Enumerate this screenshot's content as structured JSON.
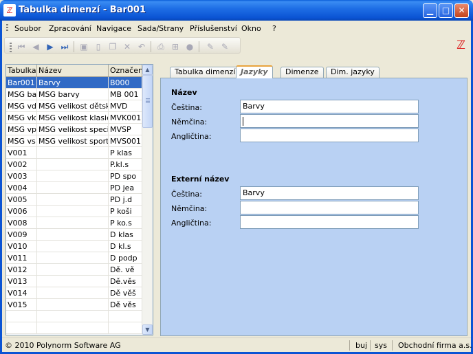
{
  "window": {
    "title": "Tabulka dimenzí - Bar001",
    "logo_icon": "polynorm-logo-icon",
    "accent_color": "#0b54d4"
  },
  "menu": {
    "items": [
      "Soubor",
      "Zpracování",
      "Navigace",
      "Sada/Strany",
      "Příslušenství",
      "Okno",
      "?"
    ]
  },
  "toolbar": {
    "buttons": [
      "first-record-icon",
      "previous-record-icon",
      "next-record-icon",
      "last-record-icon",
      "save-icon",
      "new-icon",
      "copy-icon",
      "delete-icon",
      "undo-icon",
      "print-icon",
      "tree-icon",
      "stop-icon",
      "edit-icon",
      "edit-alt-icon"
    ]
  },
  "grid": {
    "columns": [
      "Tabulka",
      "Název",
      "Označen"
    ],
    "rows": [
      {
        "c1": "Bar001",
        "c2": "Barvy",
        "c3": "B000",
        "selected": true
      },
      {
        "c1": "MSG ba",
        "c2": "MSG barvy",
        "c3": "MB 001"
      },
      {
        "c1": "MSG vd",
        "c2": "MSG velikost dětská",
        "c3": "MVD"
      },
      {
        "c1": "MSG vk",
        "c2": "MSG velikost klasick.",
        "c3": "MVK001"
      },
      {
        "c1": "MSG vp",
        "c2": "MSG velikost speciál",
        "c3": "MVSP"
      },
      {
        "c1": "MSG vs",
        "c2": "MSG velikost sportov",
        "c3": "MVS001"
      },
      {
        "c1": "V001",
        "c2": "",
        "c3": "P klas"
      },
      {
        "c1": "V002",
        "c2": "",
        "c3": "P.kl.s"
      },
      {
        "c1": "V003",
        "c2": "",
        "c3": "PD spo"
      },
      {
        "c1": "V004",
        "c2": "",
        "c3": "PD jea"
      },
      {
        "c1": "V005",
        "c2": "",
        "c3": "PD j.d"
      },
      {
        "c1": "V006",
        "c2": "",
        "c3": "P koši"
      },
      {
        "c1": "V008",
        "c2": "",
        "c3": "P ko.s"
      },
      {
        "c1": "V009",
        "c2": "",
        "c3": "D klas"
      },
      {
        "c1": "V010",
        "c2": "",
        "c3": "D kl.s"
      },
      {
        "c1": "V011",
        "c2": "",
        "c3": "D podp"
      },
      {
        "c1": "V012",
        "c2": "",
        "c3": "Dě. vě"
      },
      {
        "c1": "V013",
        "c2": "",
        "c3": "Dě.věs"
      },
      {
        "c1": "V014",
        "c2": "",
        "c3": "Dě věš"
      },
      {
        "c1": "V015",
        "c2": "",
        "c3": "Dě věs"
      },
      {
        "c1": "",
        "c2": "",
        "c3": ""
      },
      {
        "c1": "",
        "c2": "",
        "c3": ""
      }
    ]
  },
  "tabs": {
    "items": [
      "Tabulka dimenzí",
      "Jazyky",
      "Dimenze",
      "Dim. jazyky"
    ],
    "active": "Jazyky"
  },
  "form": {
    "name_section": {
      "title": "Název",
      "fields": [
        {
          "label": "Čeština:",
          "value": "Barvy"
        },
        {
          "label": "Němčina:",
          "value": ""
        },
        {
          "label": "Angličtina:",
          "value": ""
        }
      ]
    },
    "external_section": {
      "title": "Externí název",
      "fields": [
        {
          "label": "Čeština:",
          "value": "Barvy"
        },
        {
          "label": "Němčina:",
          "value": ""
        },
        {
          "label": "Angličtina:",
          "value": ""
        }
      ]
    }
  },
  "status": {
    "copyright": "© 2010 Polynorm Software AG",
    "user": "buj",
    "db": "sys",
    "company": "Obchodní firma a.s."
  }
}
